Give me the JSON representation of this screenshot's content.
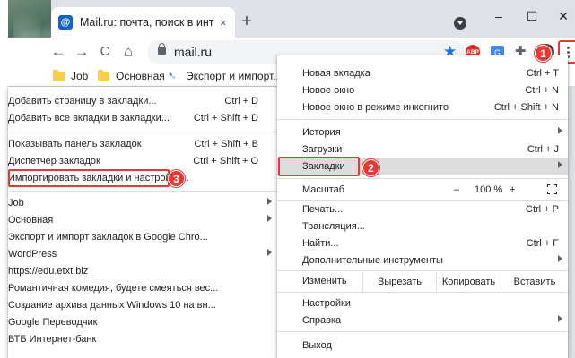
{
  "tab": {
    "favicon": "@",
    "title": "Mail.ru: почта, поиск в интернет",
    "close": "×"
  },
  "newtab": "+",
  "window_controls": {
    "minimize": "–",
    "maximize": "☐",
    "close": "✕"
  },
  "toolbar": {
    "back": "←",
    "forward": "→",
    "reload": "C",
    "home": "⌂",
    "url": "mail.ru",
    "star": "★",
    "abp": "ABP"
  },
  "bookmarks_bar": [
    {
      "label": "Job"
    },
    {
      "label": "Основная"
    },
    {
      "label": "Экспорт и импорт..."
    }
  ],
  "bookmarks_menu": {
    "items": [
      {
        "label": "Добавить страницу в закладки...",
        "shortcut": "Ctrl + D"
      },
      {
        "label": "Добавить все вкладки в закладки...",
        "shortcut": "Ctrl + Shift + D"
      },
      {
        "label": "Показывать панель закладок",
        "shortcut": "Ctrl + Shift + B"
      },
      {
        "label": "Диспетчер закладок",
        "shortcut": "Ctrl + Shift + O"
      },
      {
        "label": "Импортировать закладки и настройки...",
        "shortcut": ""
      },
      {
        "label": "Job",
        "shortcut": ""
      },
      {
        "label": "Основная",
        "shortcut": ""
      },
      {
        "label": "Экспорт и импорт закладок в Google Chro...",
        "shortcut": ""
      },
      {
        "label": "WordPress",
        "shortcut": ""
      },
      {
        "label": "https://edu.etxt.biz",
        "shortcut": ""
      },
      {
        "label": "Романтичная комедия, будете смеяться вес...",
        "shortcut": ""
      },
      {
        "label": "Создание архива данных Windows 10 на вн...",
        "shortcut": ""
      },
      {
        "label": "Google Переводчик",
        "shortcut": ""
      },
      {
        "label": "ВТБ Интернет-банк",
        "shortcut": ""
      }
    ]
  },
  "main_menu": {
    "new_tab": {
      "label": "Новая вкладка",
      "shortcut": "Ctrl + T"
    },
    "new_window": {
      "label": "Новое окно",
      "shortcut": "Ctrl + N"
    },
    "incognito": {
      "label": "Новое окно в режиме инкогнито",
      "shortcut": "Ctrl + Shift + N"
    },
    "history": {
      "label": "История"
    },
    "downloads": {
      "label": "Загрузки",
      "shortcut": "Ctrl + J"
    },
    "bookmarks": {
      "label": "Закладки"
    },
    "zoom": {
      "label": "Масштаб",
      "minus": "–",
      "value": "100 %",
      "plus": "+"
    },
    "print": {
      "label": "Печать...",
      "shortcut": "Ctrl + P"
    },
    "cast": {
      "label": "Трансляция..."
    },
    "find": {
      "label": "Найти...",
      "shortcut": "Ctrl + F"
    },
    "more_tools": {
      "label": "Дополнительные инструменты"
    },
    "edit": {
      "label": "Изменить",
      "cut": "Вырезать",
      "copy": "Копировать",
      "paste": "Вставить"
    },
    "settings": {
      "label": "Настройки"
    },
    "help": {
      "label": "Справка"
    },
    "exit": {
      "label": "Выход"
    }
  },
  "badges": {
    "one": "1",
    "two": "2",
    "three": "3"
  },
  "colors": {
    "annotation": "#e53935",
    "highlight": "#dcdcdc",
    "accent": "#1a73e8"
  }
}
